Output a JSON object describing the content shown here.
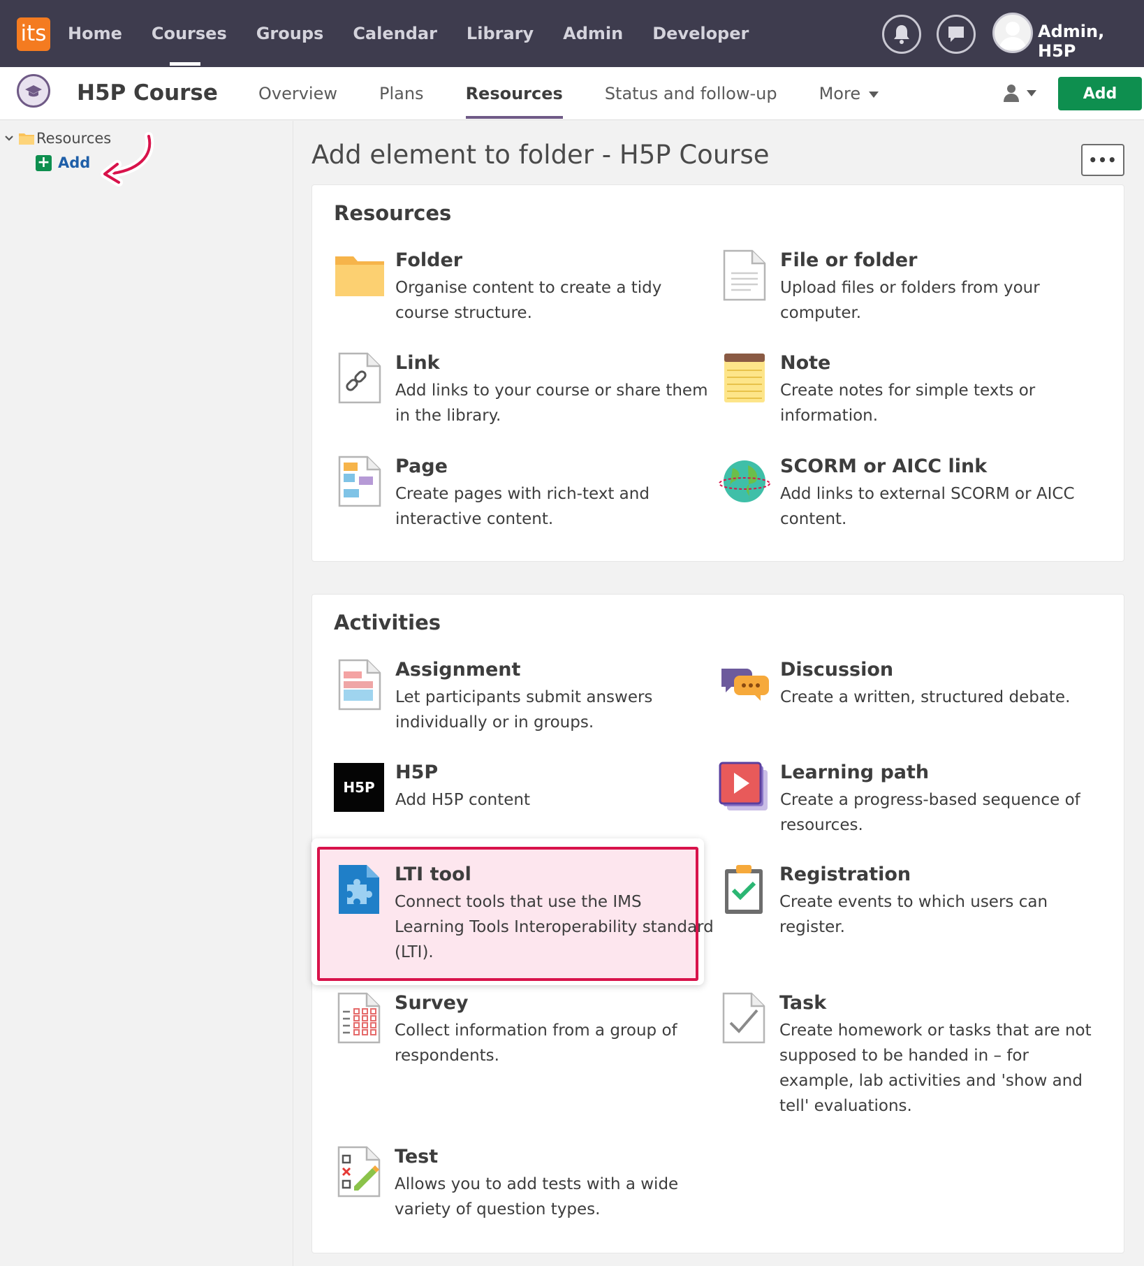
{
  "topbar": {
    "logo": "its",
    "nav": [
      "Home",
      "Courses",
      "Groups",
      "Calendar",
      "Library",
      "Admin",
      "Developer"
    ],
    "active_nav": "Courses",
    "user_name": "Admin, H5P"
  },
  "course": {
    "title": "H5P Course",
    "tabs": [
      "Overview",
      "Plans",
      "Resources",
      "Status and follow-up",
      "More"
    ],
    "active_tab": "Resources",
    "add_label": "Add"
  },
  "sidebar": {
    "root_label": "Resources",
    "add_label": "Add"
  },
  "main": {
    "title": "Add element to folder - H5P Course",
    "more_label": "•••",
    "resources": {
      "heading": "Resources",
      "items": [
        {
          "name": "Folder",
          "desc": "Organise content to create a tidy course structure.",
          "icon": "folder-icon"
        },
        {
          "name": "File or folder",
          "desc": "Upload files or folders from your computer.",
          "icon": "file-icon"
        },
        {
          "name": "Link",
          "desc": "Add links to your course or share them in the library.",
          "icon": "link-icon"
        },
        {
          "name": "Note",
          "desc": "Create notes for simple texts or information.",
          "icon": "note-icon"
        },
        {
          "name": "Page",
          "desc": "Create pages with rich-text and interactive content.",
          "icon": "page-icon"
        },
        {
          "name": "SCORM or AICC link",
          "desc": "Add links to external SCORM or AICC content.",
          "icon": "globe-icon"
        }
      ]
    },
    "activities": {
      "heading": "Activities",
      "items": [
        {
          "name": "Assignment",
          "desc": "Let participants submit answers individually or in groups.",
          "icon": "assignment-icon"
        },
        {
          "name": "Discussion",
          "desc": "Create a written, structured debate.",
          "icon": "discussion-icon"
        },
        {
          "name": "H5P",
          "desc": "Add H5P content",
          "icon": "h5p-icon"
        },
        {
          "name": "Learning path",
          "desc": "Create a progress-based sequence of resources.",
          "icon": "learning-path-icon"
        },
        {
          "name": "LTI tool",
          "desc": "Connect tools that use the IMS Learning Tools Interoperability standard (LTI).",
          "icon": "puzzle-icon"
        },
        {
          "name": "Registration",
          "desc": "Create events to which users can register.",
          "icon": "clipboard-icon"
        },
        {
          "name": "Survey",
          "desc": "Collect information from a group of respondents.",
          "icon": "survey-icon"
        },
        {
          "name": "Task",
          "desc": "Create homework or tasks that are not supposed to be handed in – for example, lab activities and 'show and tell' evaluations.",
          "icon": "task-icon"
        },
        {
          "name": "Test",
          "desc": "Allows you to add tests with a wide variety of question types.",
          "icon": "test-icon"
        }
      ]
    }
  },
  "colors": {
    "topbar": "#3e3c4e",
    "accent": "#6f5a86",
    "add_green": "#0e8f4f",
    "highlight_border": "#d8134b",
    "highlight_fill": "#fde6ee",
    "logo_orange": "#f47b20"
  }
}
